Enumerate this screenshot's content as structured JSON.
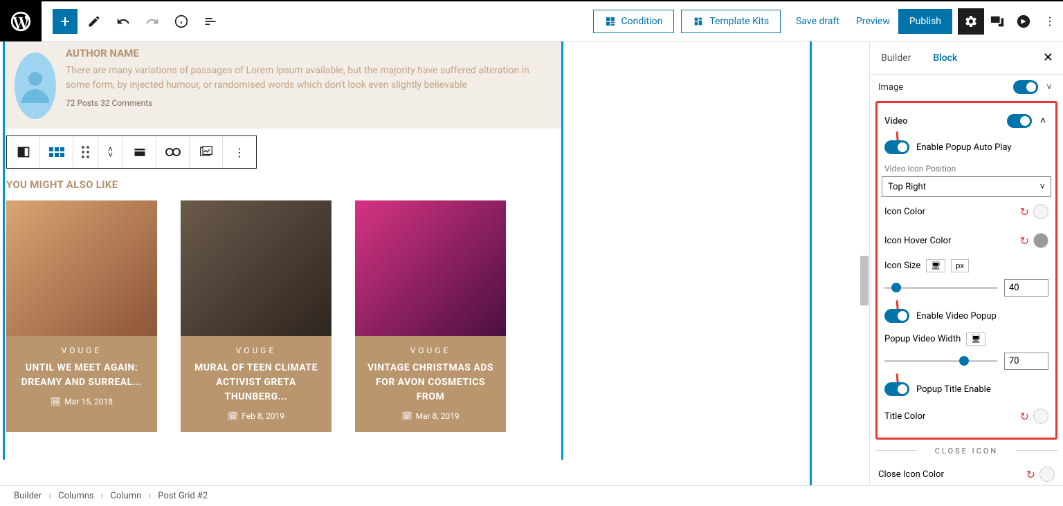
{
  "topbar": {
    "condition_label": "Condition",
    "template_kits_label": "Template Kits",
    "save_draft": "Save draft",
    "preview": "Preview",
    "publish": "Publish"
  },
  "author": {
    "name": "AUTHOR NAME",
    "bio": "There are many variations of passages of Lorem Ipsum available, but the majority have suffered alteration in some form, by injected humour, or randomised words which don't look even slightly believable",
    "meta": "72 Posts  32 Comments"
  },
  "section_title": "YOU MIGHT ALSO LIKE",
  "cards": [
    {
      "cat": "VOUGE",
      "title": "UNTIL WE MEET AGAIN: DREAMY AND SURREAL...",
      "date": "Mar 15, 2018"
    },
    {
      "cat": "VOUGE",
      "title": "MURAL OF TEEN CLIMATE ACTIVIST GRETA THUNBERG...",
      "date": "Feb 8, 2019"
    },
    {
      "cat": "VOUGE",
      "title": "VINTAGE CHRISTMAS ADS FOR AVON COSMETICS FROM",
      "date": "Mar 8, 2019"
    }
  ],
  "sidebar": {
    "tabs": {
      "builder": "Builder",
      "block": "Block"
    },
    "image_label": "Image",
    "video": {
      "header": "Video",
      "auto_play": "Enable Popup Auto Play",
      "icon_position_label": "Video Icon Position",
      "icon_position_value": "Top Right",
      "icon_color": "Icon Color",
      "icon_hover_color": "Icon Hover Color",
      "icon_size_label": "Icon Size",
      "icon_size_unit": "px",
      "icon_size_value": "40",
      "enable_popup": "Enable Video Popup",
      "popup_width_label": "Popup Video Width",
      "popup_width_value": "70",
      "popup_title_enable": "Popup Title Enable",
      "title_color": "Title Color",
      "close_icon_divider": "CLOSE ICON",
      "close_icon_color": "Close Icon Color"
    }
  },
  "breadcrumb": [
    "Builder",
    "Columns",
    "Column",
    "Post Grid #2"
  ]
}
